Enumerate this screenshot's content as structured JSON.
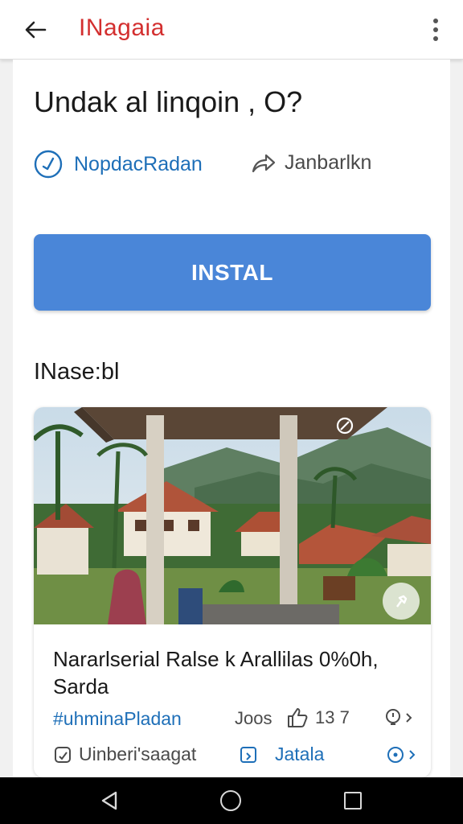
{
  "app_bar": {
    "title": "INagaia"
  },
  "header": {
    "headline": "Undak al linqoin   , O?",
    "verified_label": "NopdacRadan",
    "share_label": "Janbarlkn"
  },
  "install_button": {
    "label": "INSTAL"
  },
  "section": {
    "title": "INase:bl"
  },
  "card": {
    "title": "Nararlserial Ralse k Arallilas 0%0h, Sarda",
    "hashtag": "#uhminaPladan",
    "jobs_label": "Joos",
    "likes": "13 7",
    "category": "Uinberi'saagat",
    "link_label": "Jatala"
  },
  "colors": {
    "accent": "#4a86d8",
    "brand": "#d32f2f",
    "link": "#1e6fb8"
  },
  "icons": {
    "back": "arrow-left-icon",
    "more": "more-vert-icon",
    "verified": "check-circle-icon",
    "share": "share-arrow-icon",
    "like": "thumbs-up-icon",
    "info": "lightbulb-icon",
    "category": "tag-icon",
    "link": "external-link-icon",
    "next": "circle-chevron-icon"
  }
}
